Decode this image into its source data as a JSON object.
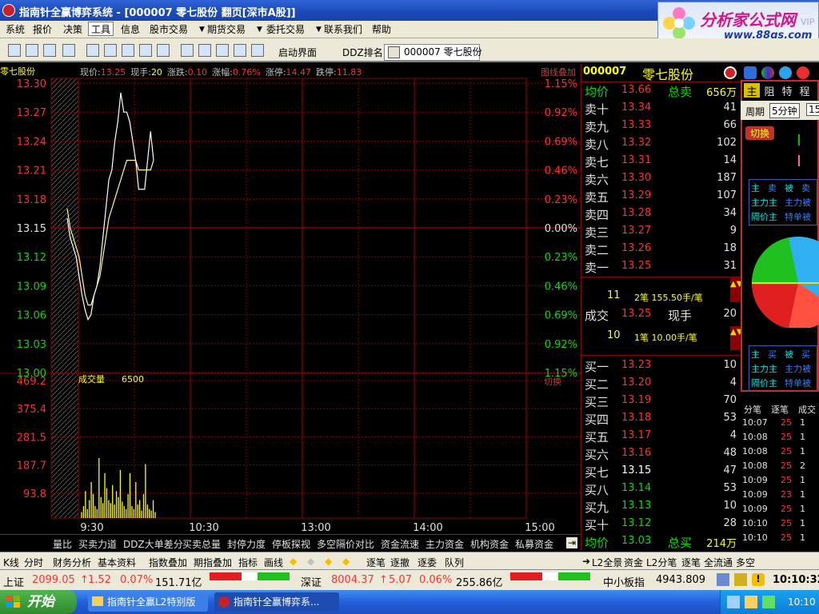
{
  "window": {
    "title": "指南针全赢博弈系统 - [000007 零七股份 翻页[深市A股]]"
  },
  "brand": {
    "name": "分析家公式网",
    "url": "www.88gs.com",
    "bg_text": "VIP"
  },
  "menu": {
    "items": [
      "系统",
      "报价",
      "决策",
      "工具",
      "信息",
      "股市交易",
      "期货交易",
      "委托交易",
      "联系我们",
      "帮助"
    ],
    "active_index": 3
  },
  "toolbar": {
    "launch_label": "启动界面",
    "ddz_label": "DDZ排名",
    "stock_tab": "000007 零七股份"
  },
  "info": {
    "stock_short": "零七股份",
    "fields": [
      {
        "label": "现价:",
        "value": "13.25"
      },
      {
        "label": "现手:",
        "value": "20"
      },
      {
        "label": "涨跌:",
        "value": "0.10"
      },
      {
        "label": "涨幅:",
        "value": "0.76%"
      },
      {
        "label": "涨停:",
        "value": "14.47"
      },
      {
        "label": "跌停:",
        "value": "11.83"
      }
    ],
    "overlay_label": "图线叠加",
    "switch_label": "切换"
  },
  "price_axis": {
    "left": [
      "13.30",
      "13.27",
      "13.24",
      "13.21",
      "13.18",
      "13.15",
      "13.12",
      "13.09",
      "13.06",
      "13.03",
      "13.00"
    ],
    "right": [
      "1.15%",
      "0.92%",
      "0.69%",
      "0.46%",
      "0.23%",
      "0.00%",
      "0.23%",
      "0.46%",
      "0.69%",
      "0.92%",
      "1.15%"
    ]
  },
  "volume_axis": {
    "labels": [
      "469.2",
      "375.4",
      "281.5",
      "187.7",
      "93.8"
    ],
    "title": "成交量",
    "title_value": "6500"
  },
  "time_axis": [
    "9:30",
    "10:30",
    "13:00",
    "14:00",
    "15:00"
  ],
  "order_book": {
    "code": "000007",
    "name": "零七股份",
    "avg_label": "均价",
    "avg_price": "13.66",
    "total_sell_label": "总卖",
    "total_sell": "656万",
    "asks": [
      {
        "label": "卖十",
        "price": "13.34",
        "vol": "41"
      },
      {
        "label": "卖九",
        "price": "13.33",
        "vol": "66"
      },
      {
        "label": "卖八",
        "price": "13.32",
        "vol": "102"
      },
      {
        "label": "卖七",
        "price": "13.31",
        "vol": "14"
      },
      {
        "label": "卖六",
        "price": "13.30",
        "vol": "187"
      },
      {
        "label": "卖五",
        "price": "13.29",
        "vol": "107"
      },
      {
        "label": "卖四",
        "price": "13.28",
        "vol": "34"
      },
      {
        "label": "卖三",
        "price": "13.27",
        "vol": "9"
      },
      {
        "label": "卖二",
        "price": "13.26",
        "vol": "18"
      },
      {
        "label": "卖一",
        "price": "13.25",
        "vol": "31"
      }
    ],
    "ask_summary": {
      "count": "11",
      "text": "2笔 155.50手/笔"
    },
    "trade": {
      "label": "成交",
      "price": "13.25",
      "vol_label": "现手",
      "vol": "20"
    },
    "bid_summary": {
      "count": "10",
      "text": "1笔 10.00手/笔"
    },
    "bids": [
      {
        "label": "买一",
        "price": "13.23",
        "vol": "10"
      },
      {
        "label": "买二",
        "price": "13.20",
        "vol": "4"
      },
      {
        "label": "买三",
        "price": "13.19",
        "vol": "70"
      },
      {
        "label": "买四",
        "price": "13.18",
        "vol": "53"
      },
      {
        "label": "买五",
        "price": "13.17",
        "vol": "4"
      },
      {
        "label": "买六",
        "price": "13.16",
        "vol": "48"
      },
      {
        "label": "买七",
        "price": "13.15",
        "vol": "47"
      },
      {
        "label": "买八",
        "price": "13.14",
        "vol": "53"
      },
      {
        "label": "买九",
        "price": "13.13",
        "vol": "10"
      },
      {
        "label": "买十",
        "price": "13.12",
        "vol": "28"
      }
    ],
    "avg_bid_label": "均价",
    "avg_bid": "13.03",
    "total_buy_label": "总买",
    "total_buy": "214万"
  },
  "far_panel": {
    "tabs": [
      "主",
      "阻",
      "特",
      "程"
    ],
    "period_label": "周期",
    "period_value": "5分钟",
    "period_extra": "15",
    "switch_btn": "切换",
    "grid_top": [
      "主",
      "卖",
      "被",
      "卖",
      "主力主",
      "主力被",
      "隔价主",
      "特单被"
    ],
    "grid_bottom": [
      "主",
      "买",
      "被",
      "买",
      "主力主",
      "主力被",
      "隔价主",
      "特单被"
    ],
    "tick_tabs": [
      "分笔",
      "逐笔",
      "成交"
    ],
    "ticks": [
      {
        "t": "10:07",
        "p": "25",
        "v": "1"
      },
      {
        "t": "10:08",
        "p": "25",
        "v": "1"
      },
      {
        "t": "10:08",
        "p": "25",
        "v": "1"
      },
      {
        "t": "10:08",
        "p": "25",
        "v": "2"
      },
      {
        "t": "10:09",
        "p": "25",
        "v": "1"
      },
      {
        "t": "10:09",
        "p": "23",
        "v": "1"
      },
      {
        "t": "10:09",
        "p": "25",
        "v": "1"
      },
      {
        "t": "10:10",
        "p": "25",
        "v": "1"
      },
      {
        "t": "10:10",
        "p": "25",
        "v": "1"
      }
    ]
  },
  "bottom_tabs": [
    "量比",
    "买卖力道",
    "DDZ大单差分",
    "买卖总量",
    "封停力度",
    "停板探视",
    "多空隔价对比",
    "资金流速",
    "主力资金",
    "机构资金",
    "私募资金"
  ],
  "bottom_tabs2": {
    "left": [
      "K线",
      "分时",
      "财务分析",
      "基本资料"
    ],
    "mid": [
      "指数叠加",
      "期指叠加",
      "指标",
      "画线"
    ],
    "right": [
      "逐笔",
      "逐撤",
      "逐委",
      "队列"
    ],
    "far": [
      "L2全景",
      "资金",
      "L2分笔",
      "逐笔",
      "全流通",
      "多空"
    ]
  },
  "index_bar": {
    "sh_label": "上证",
    "sh_value": "2099.05",
    "sh_change": "1.52",
    "sh_pct": "0.07%",
    "sh_amount": "151.71亿",
    "sz_label": "深证",
    "sz_value": "8004.37",
    "sz_change": "5.07",
    "sz_pct": "0.06%",
    "sz_amount": "255.86亿",
    "sme_label": "中小板指",
    "sme_value": "4943.809",
    "clock": "10:10:32"
  },
  "taskbar": {
    "start": "开始",
    "tasks": [
      "指南针全赢L2特别版",
      "指南针全赢博弈系..."
    ],
    "time": "10:10"
  },
  "chart_data": {
    "type": "line",
    "title": "",
    "xlabel": "",
    "ylabel": "",
    "ylim": [
      13.0,
      13.3
    ],
    "base_price": 13.15,
    "x_ticks": [
      "9:30",
      "10:30",
      "13:00",
      "14:00",
      "15:00"
    ],
    "series": [
      {
        "values": [
          13.16,
          13.14,
          13.13,
          13.12,
          13.1,
          13.08,
          13.065,
          13.055,
          13.06,
          13.08,
          13.09,
          13.11,
          13.14,
          13.17,
          13.2,
          13.21,
          13.24,
          13.26,
          13.29,
          13.27,
          13.27,
          13.26,
          13.24,
          13.22,
          13.19,
          13.19,
          13.19,
          13.22,
          13.25,
          13.22
        ]
      },
      {
        "values": [
          13.17,
          13.15,
          13.14,
          13.13,
          13.12,
          13.1,
          13.08,
          13.07,
          13.07,
          13.08,
          13.09,
          13.1,
          13.12,
          13.14,
          13.16,
          13.17,
          13.18,
          13.19,
          13.2,
          13.21,
          13.22,
          13.22,
          13.22,
          13.22,
          13.21,
          13.21,
          13.21,
          13.21,
          13.21,
          13.22
        ]
      }
    ],
    "volume": {
      "ylim": [
        0,
        469.2
      ],
      "values": [
        20,
        40,
        90,
        30,
        60,
        120,
        80,
        40,
        30,
        200,
        70,
        50,
        150,
        100,
        60,
        50,
        110,
        45,
        90,
        70,
        160,
        55,
        40,
        30,
        80,
        150,
        40,
        30,
        120,
        45,
        60,
        25,
        80,
        180,
        45,
        30,
        25,
        60,
        20
      ]
    }
  }
}
